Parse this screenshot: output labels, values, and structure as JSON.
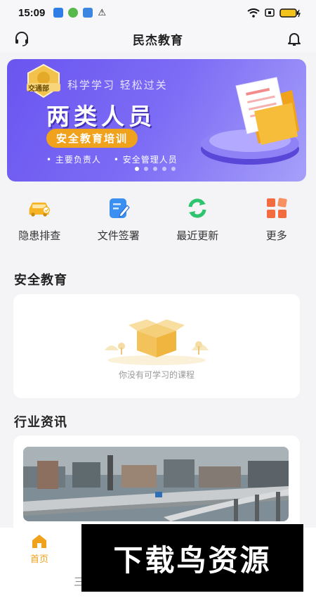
{
  "status_bar": {
    "time": "15:09"
  },
  "header": {
    "title": "民杰教育",
    "support_icon": "headset-icon",
    "notification_icon": "bell-icon"
  },
  "banner": {
    "badge": "交通部",
    "subtitle": "科学学习 轻松过关",
    "title": "两类人员",
    "pill": "安全教育培训",
    "items": [
      "• 主要负责人",
      "• 安全管理人员"
    ],
    "slide_count": 5,
    "active_slide": 1
  },
  "quick_actions": [
    {
      "label": "隐患排查",
      "icon": "car-inspection-icon",
      "color": "#f6b324"
    },
    {
      "label": "文件签署",
      "icon": "document-sign-icon",
      "color": "#3b8ff0"
    },
    {
      "label": "最近更新",
      "icon": "refresh-icon",
      "color": "#2cc46e"
    },
    {
      "label": "更多",
      "icon": "grid-more-icon",
      "color": "#f36c3f"
    }
  ],
  "safety_section": {
    "title": "安全教育",
    "empty_text": "你没有可学习的课程"
  },
  "news_section": {
    "title": "行业资讯"
  },
  "bottom_nav": {
    "home_label": "首页",
    "partial_label": "三"
  },
  "watermark": {
    "text": "下载鸟资源"
  },
  "colors": {
    "accent": "#f0a21c",
    "banner": "#6a55f0",
    "background": "#f4f4f6"
  }
}
